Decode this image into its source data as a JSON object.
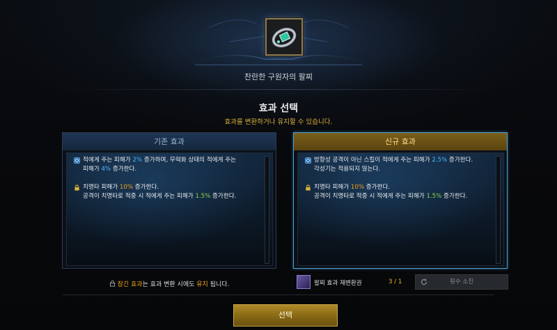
{
  "item": {
    "name": "찬란한 구원자의 팔찌",
    "icon": "bracelet-icon"
  },
  "header": {
    "title": "효과 선택",
    "subtitle": "효과를 변환하거나 유지할 수 있습니다."
  },
  "panels": {
    "current": {
      "title": "기존 효과",
      "effects": [
        {
          "icon": "effect-icon",
          "line1_a": "적에게 주는 피해가 ",
          "line1_val": "2%",
          "line1_b": " 증가하며, 무력화 상태의 적에게 주는",
          "line2_a": "피해가 ",
          "line2_val": "4%",
          "line2_b": " 증가한다."
        },
        {
          "icon": "lock-icon",
          "line1_a": "치명타 피해가 ",
          "line1_val": "10%",
          "line1_b": " 증가한다.",
          "line2_a": "공격이 치명타로 적중 시 적에게 주는 피해가 ",
          "line2_val": "1.5%",
          "line2_b": " 증가한다."
        }
      ]
    },
    "new": {
      "title": "신규 효과",
      "effects": [
        {
          "icon": "effect-icon",
          "line1_a": "방향성 공격이 아닌 스킬이 적에게 주는 피해가 ",
          "line1_val": "2.5%",
          "line1_b": " 증가한다.",
          "line2_a": "각성기는 적용되지 않는다."
        },
        {
          "icon": "lock-icon",
          "line1_a": "치명타 피해가 ",
          "line1_val": "10%",
          "line1_b": " 증가한다.",
          "line2_a": "공격이 치명타로 적중 시 적에게 주는 피해가 ",
          "line2_val": "1.5%",
          "line2_b": " 증가한다."
        }
      ]
    }
  },
  "lock_note": {
    "a": "잠긴 효과",
    "b": "는 효과 변환 시에도 ",
    "c": "유지",
    "d": " 됩니다."
  },
  "reroll": {
    "label": "팔찌 효과 재변환권",
    "count": "3 / 1",
    "button": "횟수 소진"
  },
  "select_button": "선택",
  "colors": {
    "value_blue": "#4db8ff",
    "value_orange": "#f0a020",
    "value_green": "#8fd04a",
    "gold": "#e0b33a",
    "selected_border": "#4aa3d6"
  }
}
